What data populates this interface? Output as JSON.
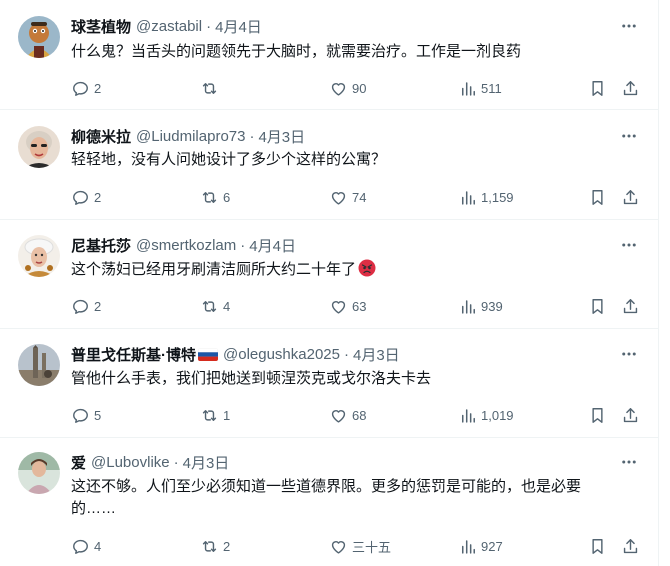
{
  "colors": {
    "text": "#0f1419",
    "muted": "#536471",
    "divider": "#eff3f4",
    "accent": "#1d9bf0"
  },
  "tweets": [
    {
      "name": "球茎植物",
      "handle": "@zastabil",
      "separator": "·",
      "time": "4月4日",
      "lines": [
        "什么鬼？当舌头的问题领先于大脑时，就需要治疗。工作是一剂良药"
      ],
      "replies": "2",
      "retweets": "",
      "likes": "90",
      "views": "511"
    },
    {
      "name": "柳德米拉",
      "handle": "@Liudmilapro73",
      "separator": "·",
      "time": "4月3日",
      "lines": [
        "轻轻地，没有人问她设计了多少个这样的公寓？"
      ],
      "replies": "2",
      "retweets": "6",
      "likes": "74",
      "views": "1,159"
    },
    {
      "name": "尼基托莎",
      "handle": "@smertkozlam",
      "separator": "·",
      "time": "4月4日",
      "lines": [
        "这个荡妇已经用牙刷清洁厕所大约二十年了"
      ],
      "emoji": "angry-face-emoji",
      "replies": "2",
      "retweets": "4",
      "likes": "63",
      "views": "939"
    },
    {
      "name": "普里戈任斯基·博特",
      "flag": "russia-flag",
      "handle": "@olegushka2025",
      "separator": "·",
      "time": "4月3日",
      "lines": [
        "管他什么手表，我们把她送到顿涅茨克或戈尔洛夫卡去"
      ],
      "replies": "5",
      "retweets": "1",
      "likes": "68",
      "views": "1,019"
    },
    {
      "name": "爱",
      "handle": "@Lubovlike",
      "separator": "·",
      "time": "4月3日",
      "lines": [
        "这还不够。人们至少必须知道一些道德界限。更多的惩罚是可能的，也是必要",
        "的……"
      ],
      "replies": "4",
      "retweets": "2",
      "likes": "三十五",
      "views": "927"
    }
  ],
  "icons": {
    "more": "more-horizontal-icon",
    "reply": "reply-icon",
    "retweet": "retweet-icon",
    "like": "heart-icon",
    "views": "views-chart-icon",
    "bookmark": "bookmark-icon",
    "share": "share-icon"
  }
}
